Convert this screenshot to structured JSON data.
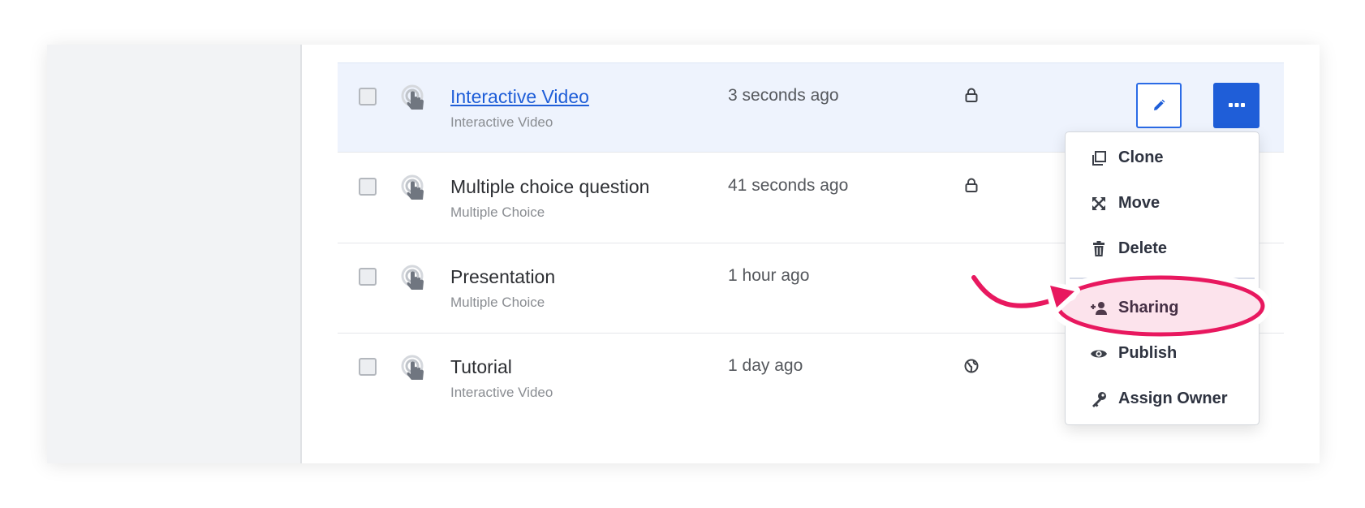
{
  "rows": [
    {
      "title": "Interactive Video",
      "subtitle": "Interactive Video",
      "time": "3 seconds ago",
      "privacy": "lock-icon"
    },
    {
      "title": "Multiple choice question",
      "subtitle": "Multiple Choice",
      "time": "41 seconds ago",
      "privacy": "lock-icon"
    },
    {
      "title": "Presentation",
      "subtitle": "Multiple Choice",
      "time": "1 hour ago",
      "privacy": ""
    },
    {
      "title": "Tutorial",
      "subtitle": "Interactive Video",
      "time": "1 day ago",
      "privacy": "globe-icon"
    }
  ],
  "actions": {
    "edit_icon": "pencil-icon",
    "more_icon": "ellipsis-icon"
  },
  "menu": {
    "items": [
      {
        "label": "Clone",
        "icon": "clone-icon"
      },
      {
        "label": "Move",
        "icon": "move-icon"
      },
      {
        "label": "Delete",
        "icon": "trash-icon"
      },
      {
        "label": "Sharing",
        "icon": "add-user-icon"
      },
      {
        "label": "Publish",
        "icon": "eye-icon"
      },
      {
        "label": "Assign Owner",
        "icon": "key-icon"
      }
    ]
  },
  "colors": {
    "accent": "#1f5ed8",
    "active_row": "#eef3fd",
    "highlight": "#e8185f",
    "highlight_fill": "#fbe3ea"
  }
}
